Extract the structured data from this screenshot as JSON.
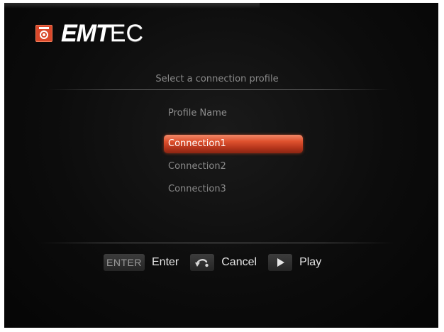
{
  "brand": {
    "name_bold": "EMT",
    "name_light": "EC",
    "accent": "#d9482b"
  },
  "title": "Select a connection profile",
  "column_header": "Profile Name",
  "profiles": [
    {
      "label": "Connection1",
      "selected": true
    },
    {
      "label": "Connection2",
      "selected": false
    },
    {
      "label": "Connection3",
      "selected": false
    }
  ],
  "help": [
    {
      "key": "ENTER",
      "label": "Enter"
    },
    {
      "key_icon": "return-arrow-icon",
      "label": "Cancel"
    },
    {
      "key_icon": "play-icon",
      "label": "Play"
    }
  ],
  "colors": {
    "background": "#0c0c0c",
    "highlight": "#e0522f",
    "text_dim": "#8a8a8a",
    "text_bright": "#e6e6e6"
  }
}
